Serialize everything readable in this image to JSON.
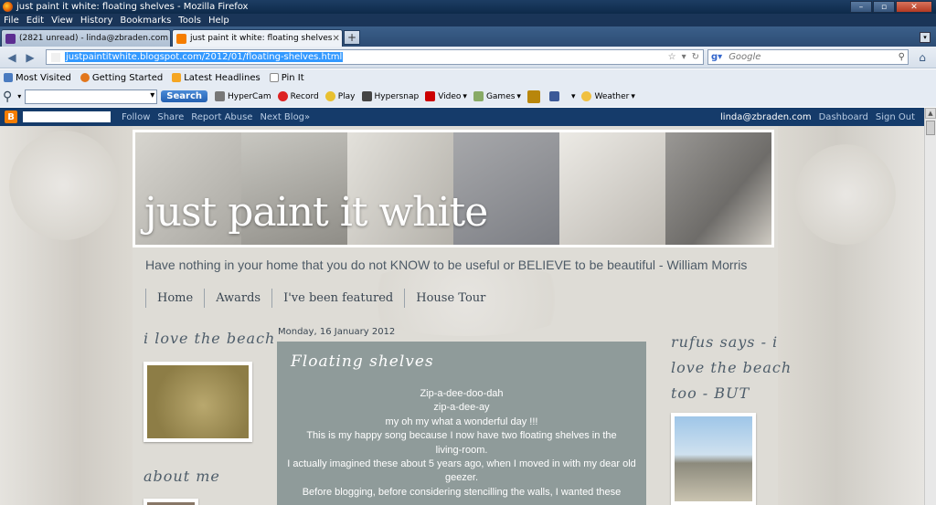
{
  "window": {
    "title": "just paint it white: floating shelves - Mozilla Firefox"
  },
  "menu": [
    "File",
    "Edit",
    "View",
    "History",
    "Bookmarks",
    "Tools",
    "Help"
  ],
  "tabs": [
    {
      "label": "(2821 unread) - linda@zbraden.com -..."
    },
    {
      "label": "just paint it white: floating shelves"
    }
  ],
  "nav": {
    "url": "justpaintitwhite.blogspot.com/2012/01/floating-shelves.html",
    "search_placeholder": "Google"
  },
  "bookmarks": [
    "Most Visited",
    "Getting Started",
    "Latest Headlines",
    "Pin It"
  ],
  "toolbar": {
    "search_button": "Search",
    "items": [
      "HyperCam",
      "Record",
      "Play",
      "Hypersnap",
      "Video",
      "Games",
      "Weather"
    ]
  },
  "blogger": {
    "links": [
      "Follow",
      "Share",
      "Report Abuse",
      "Next Blog»"
    ],
    "user": "linda@zbraden.com",
    "dashboard": "Dashboard",
    "signout": "Sign Out"
  },
  "blog": {
    "title": "just paint it white",
    "quote": "Have nothing in your home that you do not KNOW to be useful or BELIEVE to be beautiful - William Morris",
    "nav": [
      "Home",
      "Awards",
      "I've been featured",
      "House Tour"
    ],
    "left_title": "i love the beach",
    "about_title": "about me",
    "right_title_lines": [
      "rufus says - i",
      "love the beach",
      "too - BUT"
    ],
    "date": "Monday, 16 January 2012",
    "post_title": "Floating shelves",
    "post_lines": [
      "Zip-a-dee-doo-dah",
      "zip-a-dee-ay",
      "my oh my what a wonderful day !!!",
      "This is my happy song because I now have two floating shelves in the",
      "living-room.",
      "I actually imagined these about 5 years ago, when I moved in with my dear old",
      "geezer.",
      "Before blogging, before considering stencilling the walls, I wanted these"
    ]
  },
  "colors": {
    "blogger_bar": "#153b6a",
    "post_bg": "#8f9b9a",
    "url_selection": "#3399ff"
  }
}
